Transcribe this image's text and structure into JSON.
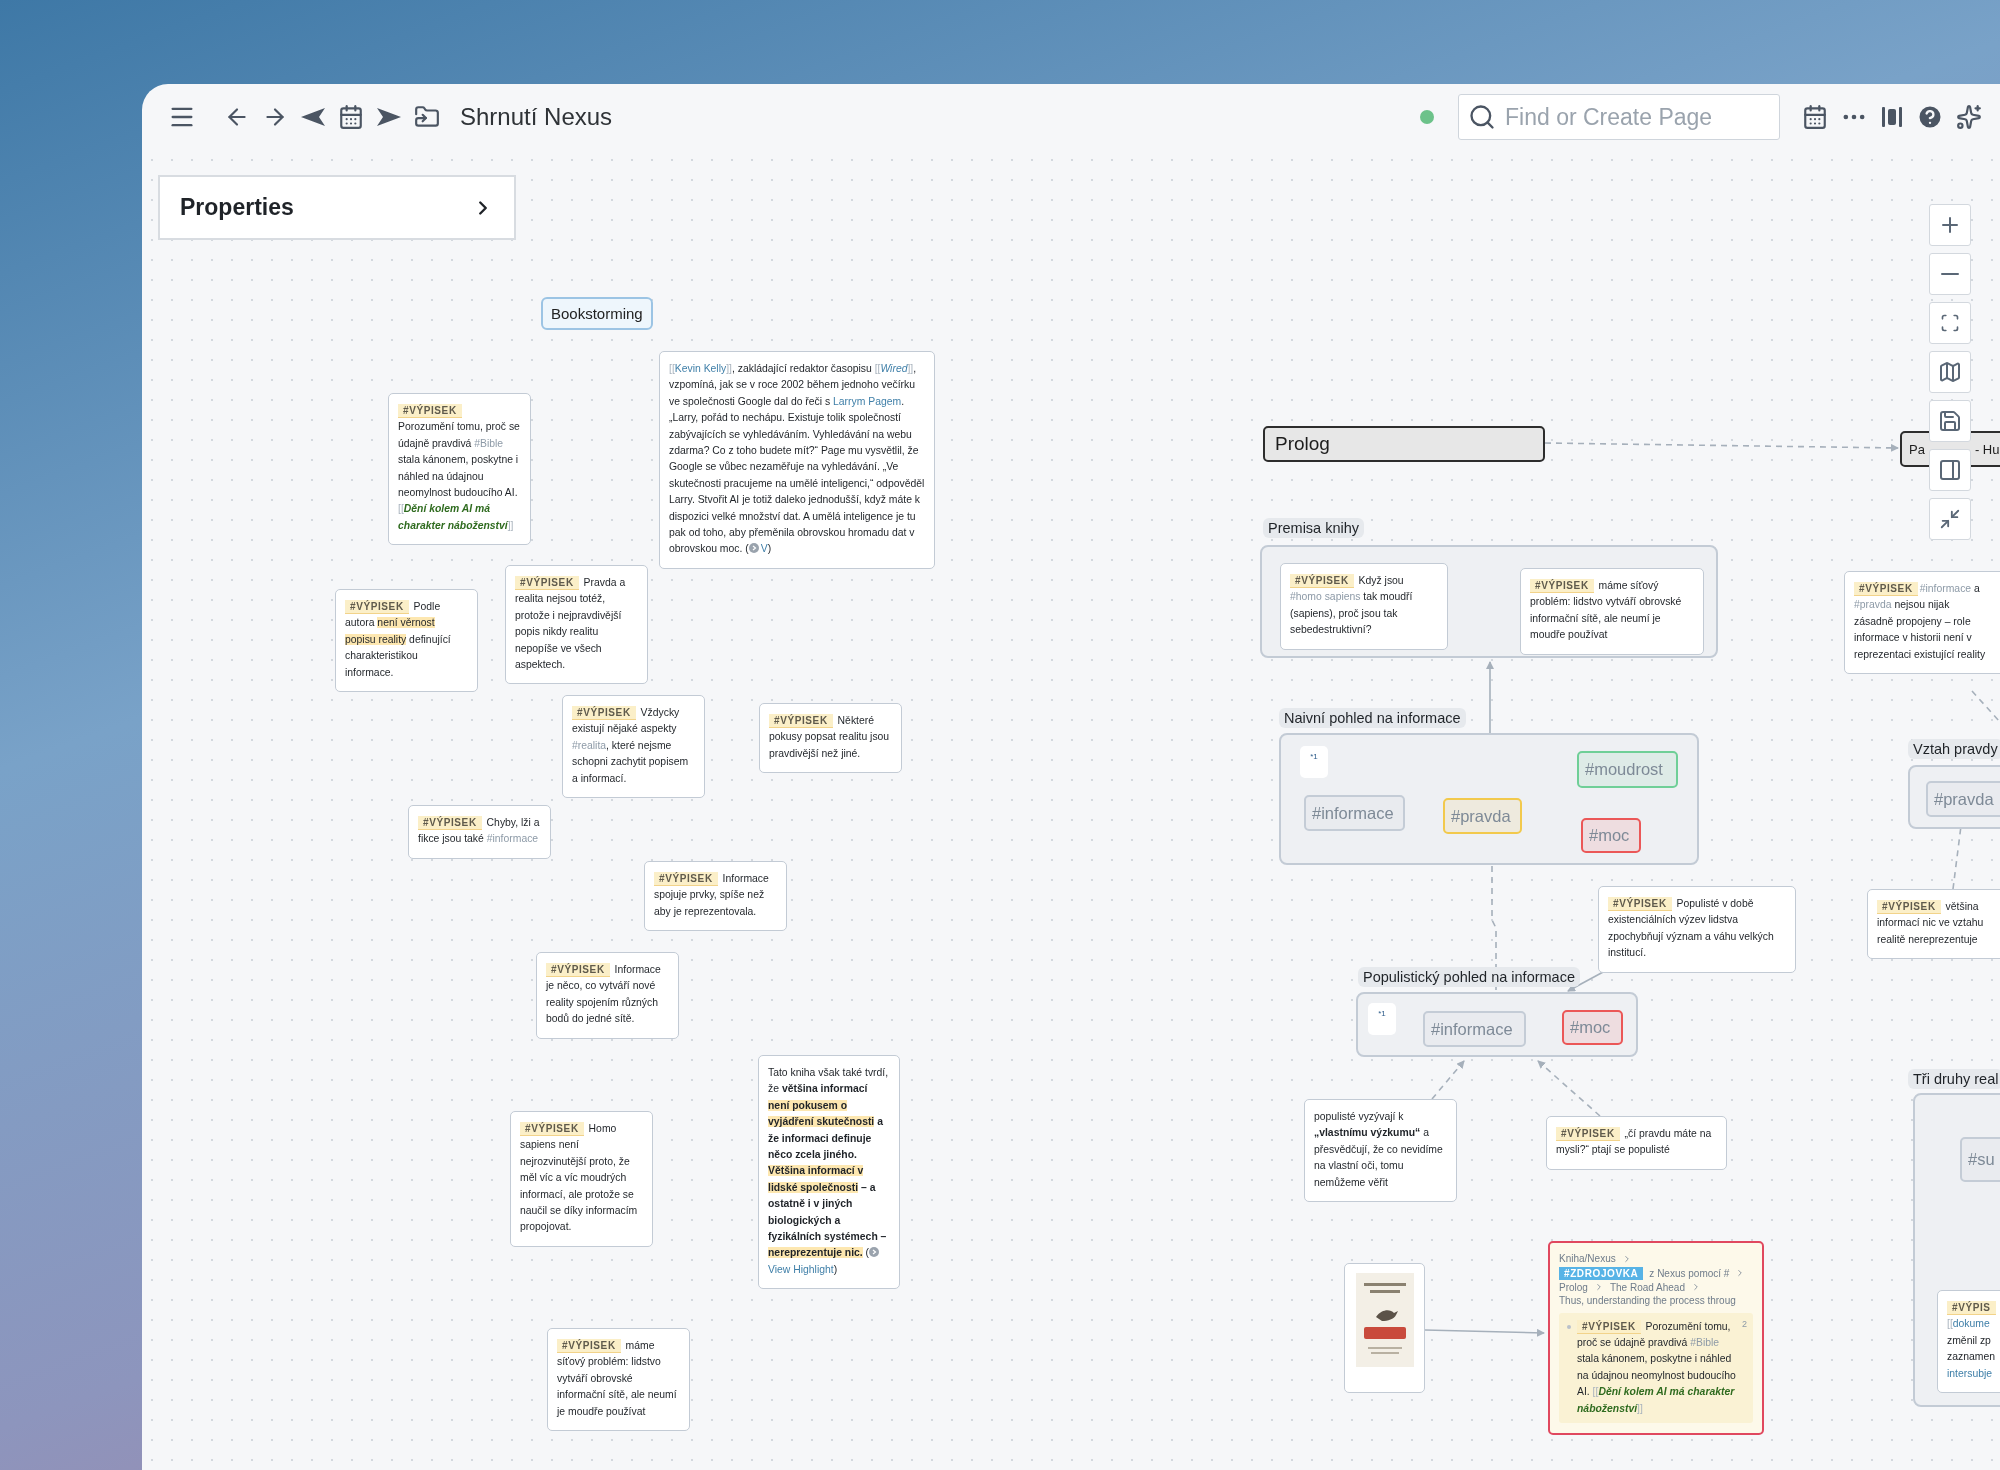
{
  "toolbar": {
    "title": "Shrnutí Nexus",
    "search": {
      "placeholder": "Find or Create Page"
    }
  },
  "properties_panel": {
    "title": "Properties",
    "expanded": false
  },
  "canvas": {
    "labels": [
      {
        "text": "Bookstorming"
      }
    ],
    "notes": [
      {
        "segments": [
          {
            "kind": "tag",
            "text": "#VÝPISEK"
          },
          {
            "kind": "text",
            "text": " Porozumění tomu, proč se údajně pravdivá "
          },
          {
            "kind": "hashtag",
            "text": "#Bible"
          },
          {
            "kind": "text",
            "text": " stala kánonem, poskytne i náhled na údajnou neomylnost budoucího AI. "
          },
          {
            "kind": "bracket",
            "text": "[["
          },
          {
            "kind": "wiki",
            "text": "Dění kolem AI má charakter náboženství"
          },
          {
            "kind": "bracket",
            "text": "]]"
          }
        ]
      },
      {
        "segments": [
          {
            "kind": "bracket",
            "text": "[["
          },
          {
            "kind": "link",
            "text": "Kevin Kelly"
          },
          {
            "kind": "bracket",
            "text": "]]"
          },
          {
            "kind": "text",
            "text": ", zakládající redaktor časopisu "
          },
          {
            "kind": "bracket",
            "text": "[["
          },
          {
            "kind": "link_italic",
            "text": "Wired"
          },
          {
            "kind": "bracket",
            "text": "]]"
          },
          {
            "kind": "text",
            "text": ", vzpomíná, jak se v roce 2002 během jednoho večírku ve společnosti Google dal do řeči s "
          },
          {
            "kind": "link",
            "text": "Larrym Pagem"
          },
          {
            "kind": "text",
            "text": ". „Larry, pořád to nechápu. Existuje tolik společností zabývajících se vyhledáváním. Vyhledávání na webu zdarma? Co z toho budete mít?“ Page mu vysvětlil, že Google se vůbec nezaměřuje na vyhledávání. „Ve skutečnosti pracujeme na umělé inteligenci,“ odpověděl Larry. Stvořit AI je totiž daleko jednodušší, když máte k dispozici velké množství dat. A umělá inteligence je tu pak od toho, aby přeměnila obrovskou hromadu dat v obrovskou moc. ("
          },
          {
            "kind": "play"
          },
          {
            "kind": "link",
            "text": "V"
          },
          {
            "kind": "text",
            "text": ")"
          }
        ]
      },
      {
        "segments": [
          {
            "kind": "tag",
            "text": "#VÝPISEK"
          },
          {
            "kind": "text",
            "text": " Podle autora "
          },
          {
            "kind": "highlight",
            "text": "není věrnost popisu reality"
          },
          {
            "kind": "text",
            "text": " definující charakteristikou informace."
          }
        ]
      },
      {
        "segments": [
          {
            "kind": "tag",
            "text": "#VÝPISEK"
          },
          {
            "kind": "text",
            "text": " Pravda a realita nejsou totéž, protože i nejpravdivější popis nikdy realitu nepopíše ve všech aspektech."
          }
        ]
      },
      {
        "segments": [
          {
            "kind": "tag",
            "text": "#VÝPISEK"
          },
          {
            "kind": "text",
            "text": " Vždycky existují nějaké aspekty "
          },
          {
            "kind": "hashtag",
            "text": "#realita"
          },
          {
            "kind": "text",
            "text": ", které nejsme schopni zachytit popisem a informací."
          }
        ]
      },
      {
        "segments": [
          {
            "kind": "tag",
            "text": "#VÝPISEK"
          },
          {
            "kind": "text",
            "text": " Některé pokusy popsat realitu jsou pravdivější než jiné."
          }
        ]
      },
      {
        "segments": [
          {
            "kind": "tag",
            "text": "#VÝPISEK"
          },
          {
            "kind": "text",
            "text": " Chyby, lži a fikce jsou také "
          },
          {
            "kind": "hashtag",
            "text": "#informace"
          }
        ]
      },
      {
        "segments": [
          {
            "kind": "tag",
            "text": "#VÝPISEK"
          },
          {
            "kind": "text",
            "text": " Informace spojuje prvky, spíše než aby je reprezentovala."
          }
        ]
      },
      {
        "segments": [
          {
            "kind": "tag",
            "text": "#VÝPISEK"
          },
          {
            "kind": "text",
            "text": " Informace je něco, co vytváří nové reality spojením různých bodů do jedné sítě."
          }
        ]
      },
      {
        "segments": [
          {
            "kind": "text",
            "text": "Tato kniha však také tvrdí, že "
          },
          {
            "kind": "bold",
            "text": "většina informací "
          },
          {
            "kind": "bold_highlight",
            "text": "není pokusem o vyjádření skutečnosti"
          },
          {
            "kind": "bold",
            "text": " a že informaci definuje něco zcela jiného. "
          },
          {
            "kind": "bold_highlight",
            "text": "Většina informací v lidské společnosti"
          },
          {
            "kind": "bold",
            "text": " – a ostatně i v jiných biologických a fyzikálních systémech – "
          },
          {
            "kind": "bold_highlight",
            "text": "nereprezentuje nic."
          },
          {
            "kind": "text",
            "text": " ("
          },
          {
            "kind": "play"
          },
          {
            "kind": "link",
            "text": "View Highlight"
          },
          {
            "kind": "text",
            "text": ")"
          }
        ]
      },
      {
        "segments": [
          {
            "kind": "tag",
            "text": "#VÝPISEK"
          },
          {
            "kind": "text",
            "text": " Homo sapiens není nejrozvinutější proto, že měl víc a víc moudrých informací, ale protože se naučil se díky informacím propojovat."
          }
        ]
      },
      {
        "segments": [
          {
            "kind": "tag",
            "text": "#VÝPISEK"
          },
          {
            "kind": "text",
            "text": "  máme síťový problém: lidstvo vytváří obrovské informační sítě, ale neumí je moudře používat"
          }
        ]
      },
      {
        "segments": [
          {
            "kind": "text",
            "text": "populisté vyzývají k "
          },
          {
            "kind": "bold",
            "text": "„vlastnímu výzkumu“"
          },
          {
            "kind": "text",
            "text": " a přesvědčují, že co nevidíme na vlastní oči, tomu nemůžeme věřit"
          }
        ]
      },
      {
        "segments": [
          {
            "kind": "tag",
            "text": "#VÝPISEK"
          },
          {
            "kind": "text",
            "text": " „čí pravdu máte na mysli?“ ptají se populisté"
          }
        ]
      },
      {
        "segments": [
          {
            "kind": "tag",
            "text": "#VÝPISEK"
          },
          {
            "kind": "text",
            "text": " Populisté v době existenciálních výzev lidstva zpochybňují význam a váhu velkých institucí."
          }
        ]
      },
      {
        "segments": [
          {
            "kind": "tag",
            "text": "#VÝPISEK"
          },
          {
            "kind": "hashtag",
            "text": "#informace"
          },
          {
            "kind": "text",
            "text": " a "
          },
          {
            "kind": "hashtag",
            "text": "#pravda"
          },
          {
            "kind": "text",
            "text": " nejsou nijak zásadně propojeny – role informace v historii není v reprezentaci existující reality"
          }
        ]
      },
      {
        "lines": [
          [
            {
              "kind": "tag",
              "text": "#VÝPISEK"
            },
            {
              "kind": "text",
              "text": " většina"
            }
          ],
          [
            {
              "kind": "text",
              "text": "informací nic ve vztahu"
            }
          ],
          [
            {
              "kind": "text",
              "text": "realitě nereprezentuje"
            }
          ]
        ]
      }
    ],
    "pages": [
      {
        "kind": "heading",
        "title": "Prolog"
      },
      {
        "kind": "covered",
        "fragments": [
          "Pa",
          "- Hu"
        ]
      }
    ],
    "groups": [
      {
        "title": "Premisa knihy",
        "notes": [
          {
            "segments": [
              {
                "kind": "tag",
                "text": "#VÝPISEK"
              },
              {
                "kind": "text",
                "text": " Když jsou "
              },
              {
                "kind": "hashtag",
                "text": "#homo sapiens"
              },
              {
                "kind": "text",
                "text": " tak moudří (sapiens), proč jsou tak sebedestruktivní?"
              }
            ]
          },
          {
            "segments": [
              {
                "kind": "tag",
                "text": "#VÝPISEK"
              },
              {
                "kind": "text",
                "text": "  máme síťový problém: lidstvo vytváří obrovské informační sítě, ale neumí je moudře používat"
              }
            ]
          }
        ]
      },
      {
        "title": "Naivní pohled na informace",
        "badge": "*1",
        "chips": [
          {
            "text": "#informace",
            "color": "#c4ccd6"
          },
          {
            "text": "#pravda",
            "color": "#f2c94c"
          },
          {
            "text": "#moudrost",
            "color": "#6fcf97"
          },
          {
            "text": "#moc",
            "color": "#eb5757"
          }
        ]
      },
      {
        "title": "Populistický pohled na informace",
        "badge": "*1",
        "chips": [
          {
            "text": "#informace",
            "color": "#c4ccd6"
          },
          {
            "text": "#moc",
            "color": "#eb5757"
          }
        ]
      },
      {
        "title": "Vztah pravdy",
        "chips": [
          {
            "text": "#pravda",
            "color": "#c4ccd6"
          }
        ]
      },
      {
        "title": "Tři druhy real",
        "chips": [
          {
            "text": "#su",
            "color": "#c4ccd6"
          }
        ],
        "notes": [
          {
            "lines": [
              [
                {
                  "kind": "tag",
                  "text": "#VÝPIS"
                }
              ],
              [
                {
                  "kind": "bracket",
                  "text": "[["
                },
                {
                  "kind": "link",
                  "text": "dokume"
                }
              ],
              [
                {
                  "kind": "text",
                  "text": "změnil zp"
                }
              ],
              [
                {
                  "kind": "text",
                  "text": "zaznamen"
                }
              ],
              [
                {
                  "kind": "link",
                  "text": "intersubje"
                }
              ]
            ]
          }
        ]
      }
    ],
    "source": {
      "path": "Kniha/Nexus",
      "badge": "#ZDROJOVKA",
      "origin": "z Nexus pomocí #",
      "chapters": [
        "Prolog",
        "The Road Ahead"
      ],
      "excerpt": "Thus, understanding the process throug",
      "block": {
        "refs": "2",
        "segments": [
          {
            "kind": "tag",
            "text": "#VÝPISEK"
          },
          {
            "kind": "text",
            "text": " Porozumění tomu, proč se údajně pravdivá "
          },
          {
            "kind": "hashtag",
            "text": "#Bible"
          },
          {
            "kind": "text",
            "text": " stala kánonem, poskytne i náhled na údajnou neomylnost budoucího AI. "
          },
          {
            "kind": "bracket",
            "text": "[["
          },
          {
            "kind": "wiki",
            "text": "Dění kolem AI má charakter náboženství"
          },
          {
            "kind": "bracket",
            "text": "]]"
          }
        ]
      }
    }
  }
}
